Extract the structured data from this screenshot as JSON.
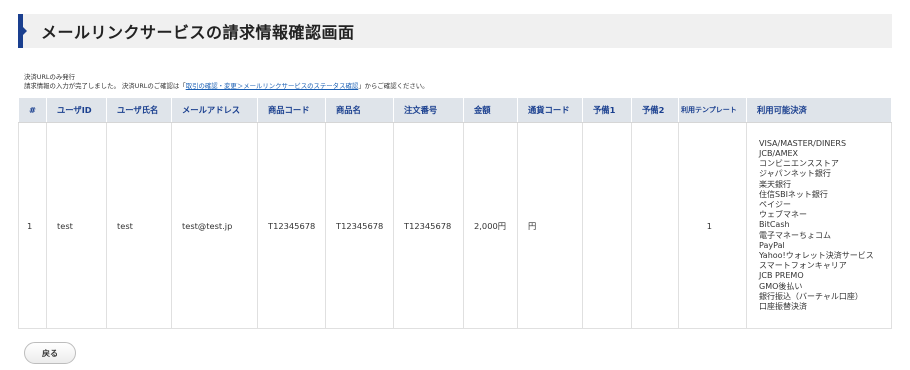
{
  "header": {
    "title": "メールリンクサービスの請求情報確認画面"
  },
  "notes": {
    "line1": "決済URLのみ発行",
    "line2_prefix": "請求情報の入力が完了しました。 決済URLのご確認は「",
    "line2_link": "取引の確認・変更＞メールリンクサービスのステータス確認",
    "line2_suffix": "」からご確認ください。"
  },
  "table": {
    "headers": [
      "#",
      "ユーザID",
      "ユーザ氏名",
      "メールアドレス",
      "商品コード",
      "商品名",
      "注文番号",
      "金額",
      "通貨コード",
      "予備1",
      "予備2",
      "利用テンプレート",
      "利用可能決済"
    ],
    "row": {
      "index": "1",
      "user_id": "test",
      "user_name": "test",
      "email": "test@test.jp",
      "product_code": "T12345678",
      "product_name": "T12345678",
      "order_number": "T12345678",
      "amount": "2,000円",
      "currency": "円",
      "reserve1": "",
      "reserve2": "",
      "template": "1",
      "payment_methods": [
        "VISA/MASTER/DINERS",
        "JCB/AMEX",
        "コンビニエンスストア",
        "ジャパンネット銀行",
        "楽天銀行",
        "住信SBIネット銀行",
        "ペイジー",
        "ウェブマネー",
        "BitCash",
        "電子マネーちょコム",
        "PayPal",
        "Yahoo!ウォレット決済サービス",
        "スマートフォンキャリア",
        "JCB PREMO",
        "GMO後払い",
        "銀行振込（バーチャル口座）",
        "口座振替決済"
      ]
    }
  },
  "actions": {
    "back_label": "戻る"
  },
  "colors": {
    "accent": "#1a3f8f",
    "header_bg": "#dfe4ea",
    "title_bg": "#f0f0f0",
    "link": "#1a5fb4"
  }
}
